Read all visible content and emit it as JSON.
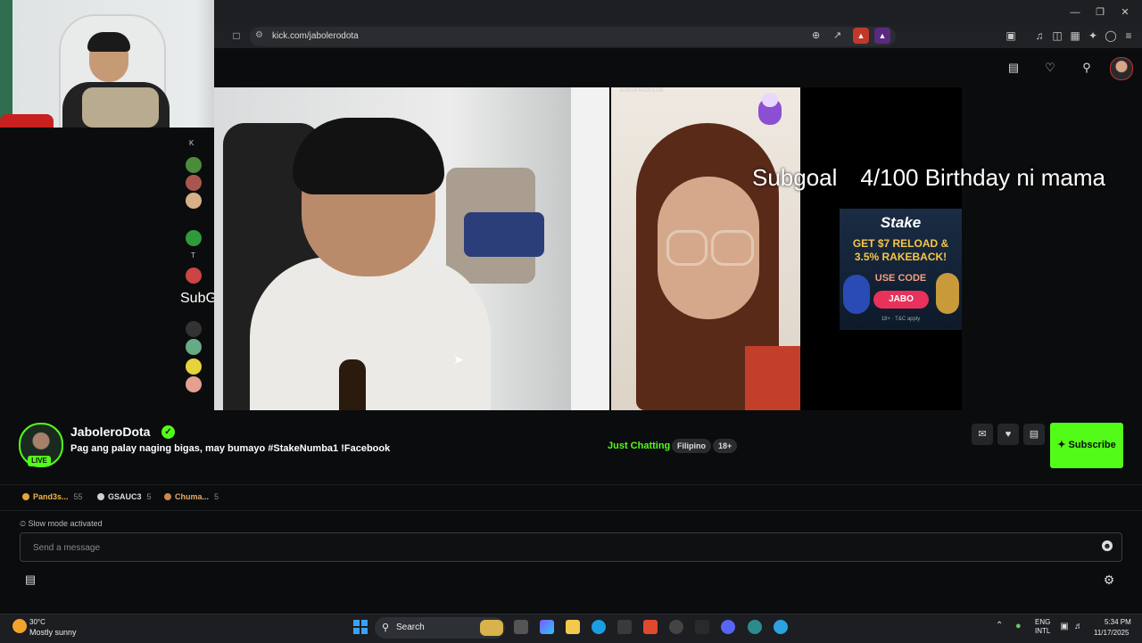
{
  "browser": {
    "url": "kick.com/jabolerodota"
  },
  "video": {
    "subgoal_label": "Subgoal",
    "subgoal_text": "4/100 Birthday ni mama",
    "mini_window_title": "KUKUFANDCLUB",
    "stake_ad": {
      "brand": "Stake",
      "promo_line1": "GET $7 RELOAD &",
      "promo_line2": "3.5% RAKEBACK!",
      "use_code": "USE CODE",
      "code": "JABO",
      "fine_print": "18+ · T&C apply"
    },
    "rail_text": "SubG",
    "rail_letters": [
      "K",
      "T"
    ]
  },
  "stream": {
    "streamer_name": "JaboleroDota",
    "live_label": "LIVE",
    "title": "Pag ang palay naging bigas, may bumayo #StakeNumba1 !Facebook",
    "category": "Just Chatting",
    "tags": [
      "Filipino",
      "18+"
    ],
    "subscribe_label": "Subscribe"
  },
  "leaderboard": [
    {
      "name": "Pand3s...",
      "count": "55",
      "color": "#e8a53a",
      "name_color": "#f0b44a"
    },
    {
      "name": "GSAUC3",
      "count": "5",
      "color": "#cfcfcf",
      "name_color": "#dddddd"
    },
    {
      "name": "Chuma...",
      "count": "5",
      "color": "#c98a4a",
      "name_color": "#e8a86a"
    }
  ],
  "chat": {
    "slow_mode": "Slow mode activated",
    "placeholder": "Send a message"
  },
  "taskbar": {
    "temperature": "30°C",
    "weather": "Mostly sunny",
    "search_label": "Search",
    "lang_line1": "ENG",
    "lang_line2": "INTL",
    "time": "5:34 PM",
    "date": "11/17/2025"
  },
  "colors": {
    "kick_green": "#53fc18",
    "background": "#0b0c0d"
  }
}
